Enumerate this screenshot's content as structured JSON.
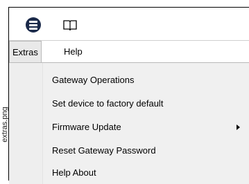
{
  "side_label": "extras.png",
  "toolbar": {
    "menu_icon": "hamburger-menu-icon",
    "help_icon": "book-icon"
  },
  "menubar": {
    "items": [
      {
        "label": "Extras"
      },
      {
        "label": "Help"
      }
    ]
  },
  "dropdown": {
    "items": [
      {
        "label": "Gateway Operations"
      },
      {
        "label": "Set device to factory default"
      },
      {
        "label": "Firmware Update",
        "has_submenu": true
      },
      {
        "label": "Reset Gateway Password"
      },
      {
        "label": "Help About"
      }
    ]
  }
}
